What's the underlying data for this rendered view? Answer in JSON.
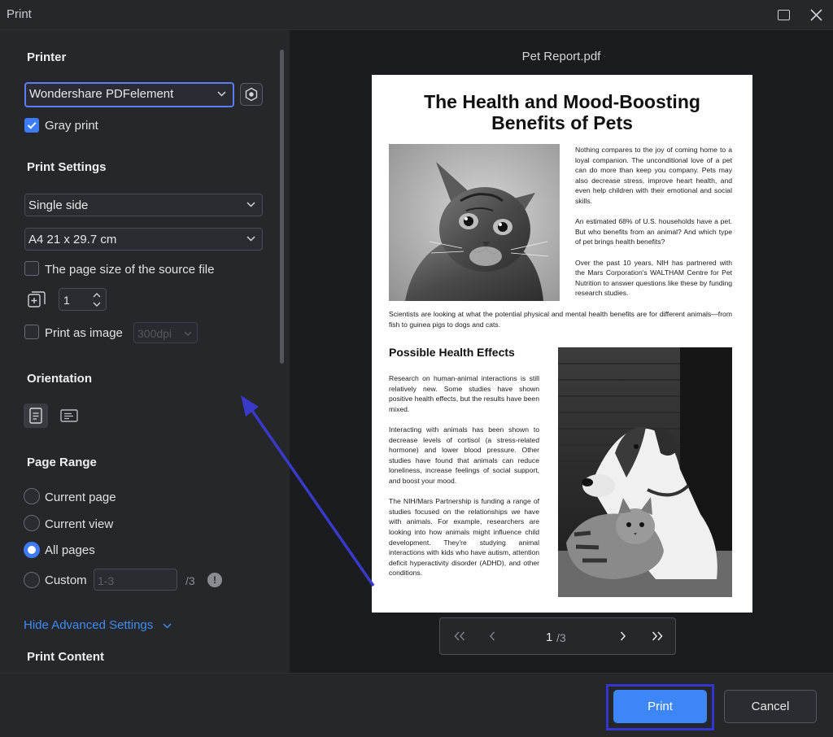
{
  "window": {
    "title": "Print"
  },
  "printer": {
    "section_title": "Printer",
    "selected": "Wondershare PDFelement",
    "gray_print_label": "Gray print",
    "gray_print_checked": true
  },
  "print_settings": {
    "section_title": "Print Settings",
    "sides": "Single side",
    "paper_size": "A4 21 x 29.7 cm",
    "source_page_size_label": "The page size of the source file",
    "copies": "1",
    "print_as_image_label": "Print as image",
    "dpi": "300dpi"
  },
  "orientation": {
    "section_title": "Orientation",
    "selected": "portrait"
  },
  "page_range": {
    "section_title": "Page Range",
    "options": [
      "Current page",
      "Current view",
      "All pages",
      "Custom"
    ],
    "selected": "All pages",
    "custom_placeholder": "1-3",
    "custom_total": "/3"
  },
  "advanced": {
    "toggle_label": "Hide Advanced Settings",
    "next_section_partial": "Print Content"
  },
  "preview": {
    "file_name": "Pet Report.pdf",
    "page_title_line1": "The Health and Mood-Boosting",
    "page_title_line2": "Benefits of Pets",
    "intro_p1": "Nothing compares to the joy of coming home to a loyal companion. The unconditional love of a pet can do more than keep you company. Pets may also decrease stress, improve heart health, and even help children with their emotional and social skills.",
    "intro_p2": "An estimated 68% of U.S. households have a pet. But who benefits from an animal? And which type of pet brings health benefits?",
    "intro_p3": "Over the past 10 years, NIH has partnered with the Mars Corporation's WALTHAM Centre for Pet Nutrition to answer questions like these by funding research studies.",
    "intro_wide": "Scientists are looking at what the potential physical and mental health benefits are for different animals—from fish to guinea pigs to dogs and cats.",
    "section_heading": "Possible Health Effects",
    "effects_p1": "Research on human-animal interactions is still relatively new. Some studies have shown positive health effects, but the results have been mixed.",
    "effects_p2": "Interacting with animals has been shown to decrease levels of cortisol (a stress-related hormone) and lower blood pressure. Other studies have found that animals can reduce loneliness, increase feelings of social support, and boost your mood.",
    "effects_p3": "The NIH/Mars Partnership is funding a range of studies focused on the relationships we have with animals. For example, researchers are looking into how animals might influence child development. They're studying animal interactions with kids who have autism, attention deficit hyperactivity disorder (ADHD), and other conditions."
  },
  "pager": {
    "current": "1",
    "total": "/3"
  },
  "footer": {
    "print_label": "Print",
    "cancel_label": "Cancel"
  },
  "colors": {
    "accent": "#3d86f7",
    "highlight_box": "#3434d0",
    "annotation_arrow": "#3a3ac8"
  }
}
